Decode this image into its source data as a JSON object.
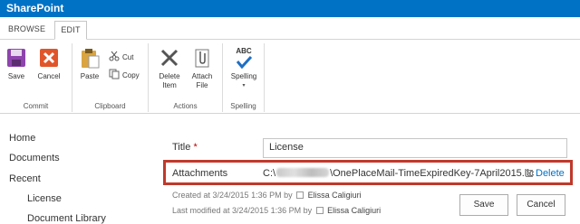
{
  "suite": {
    "brand": "SharePoint"
  },
  "tabs": [
    {
      "label": "BROWSE"
    },
    {
      "label": "EDIT"
    }
  ],
  "ribbon": {
    "commit": {
      "group_label": "Commit",
      "save": "Save",
      "cancel": "Cancel"
    },
    "clipboard": {
      "group_label": "Clipboard",
      "paste": "Paste",
      "cut": "Cut",
      "copy": "Copy"
    },
    "actions": {
      "group_label": "Actions",
      "delete_item": [
        "Delete",
        "Item"
      ],
      "attach_file": [
        "Attach",
        "File"
      ]
    },
    "spelling": {
      "group_label": "Spelling",
      "button": "Spelling",
      "icon_text": "ABC"
    }
  },
  "nav": {
    "items": [
      "Home",
      "Documents",
      "Recent",
      "License",
      "Document Library"
    ]
  },
  "form": {
    "title_label": "Title",
    "required_marker": "*",
    "title_value": "License",
    "attachments_label": "Attachments",
    "attachment_prefix": "C:\\",
    "attachment_suffix": "\\OnePlaceMail-TimeExpiredKey-7April2015.lic",
    "delete_label": "Delete",
    "created_text": "Created at 3/24/2015 1:36 PM  by",
    "created_user": "Elissa Caligiuri",
    "modified_text": "Last modified at 3/24/2015 1:36 PM  by",
    "modified_user": "Elissa Caligiuri",
    "save": "Save",
    "cancel": "Cancel"
  },
  "colors": {
    "suite_bar": "#0072c6",
    "highlight": "#c0392b",
    "link": "#0072c6"
  }
}
